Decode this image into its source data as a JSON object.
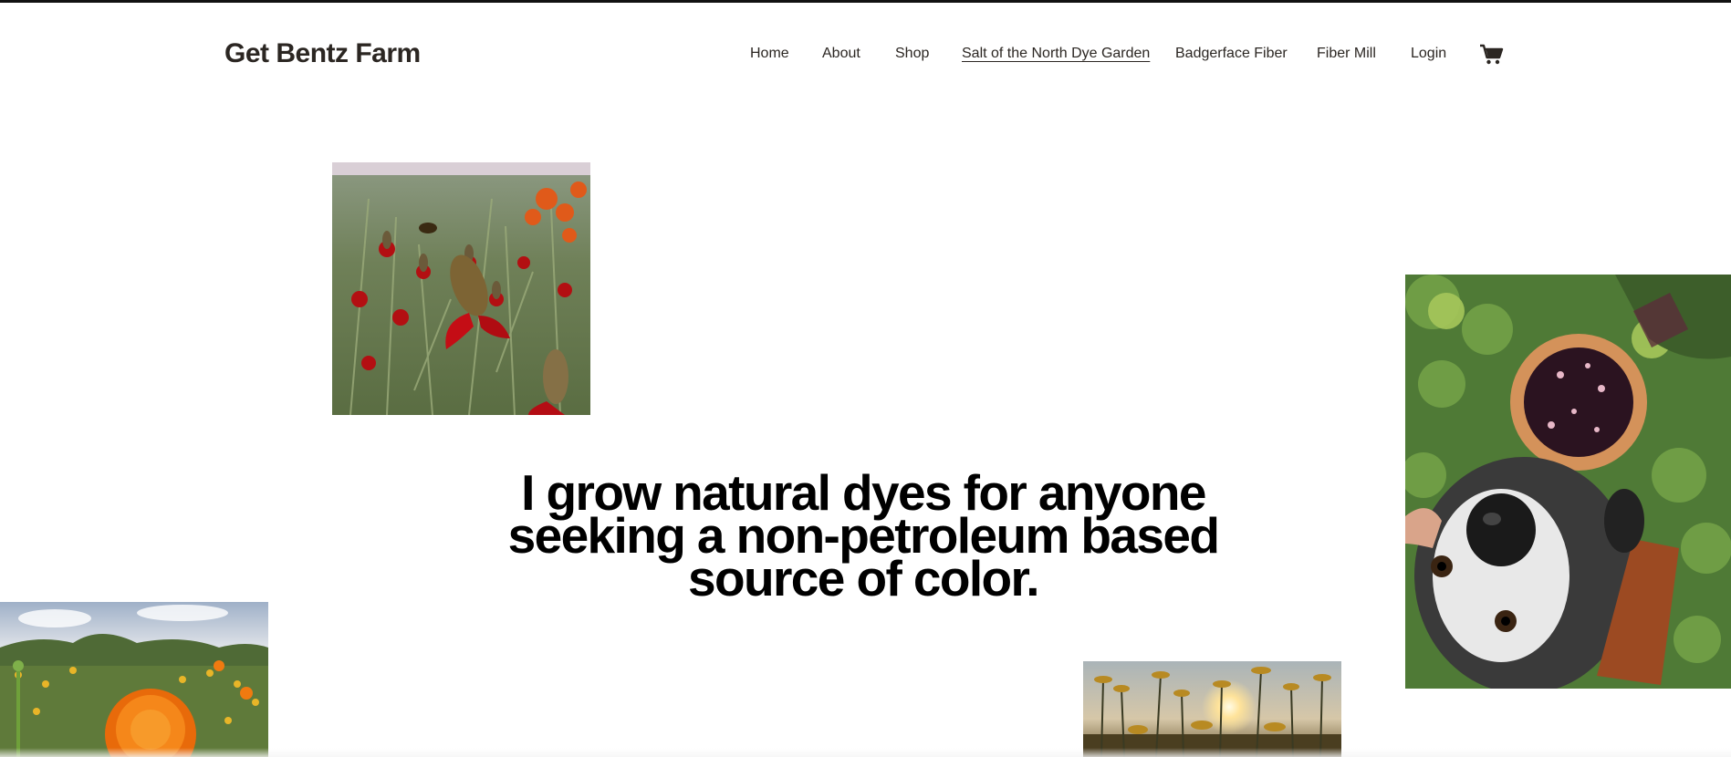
{
  "site": {
    "title": "Get Bentz Farm"
  },
  "nav": {
    "items": [
      {
        "label": "Home",
        "name": "nav-home",
        "x": 0
      },
      {
        "label": "About",
        "name": "nav-about",
        "x": 0
      },
      {
        "label": "Shop",
        "name": "nav-shop",
        "x": 0
      },
      {
        "label": "Salt of the North Dye Garden",
        "name": "nav-dye-garden",
        "x": 0
      },
      {
        "label": "Badgerface Fiber",
        "name": "nav-badgerface-fiber",
        "x": 0
      },
      {
        "label": "Fiber Mill",
        "name": "nav-fiber-mill",
        "x": 0
      },
      {
        "label": "Login",
        "name": "nav-login",
        "x": 0
      }
    ],
    "active": "Salt of the North Dye Garden",
    "cart_icon": "cart-icon"
  },
  "hero": {
    "headline": "I grow natural dyes for anyone seeking a non-petroleum based source of color."
  },
  "photos": [
    {
      "name": "red-coneflower-photo",
      "subject": "red-coneflower"
    },
    {
      "name": "dog-and-bucket-photo",
      "subject": "dog-and-bucket"
    },
    {
      "name": "marigold-photo",
      "subject": "marigold"
    },
    {
      "name": "sunset-flowers-photo",
      "subject": "sunset-flowers"
    }
  ],
  "colors": {
    "text": "#2b2622",
    "headline": "#000000",
    "background": "#ffffff",
    "topbar": "#111111"
  }
}
